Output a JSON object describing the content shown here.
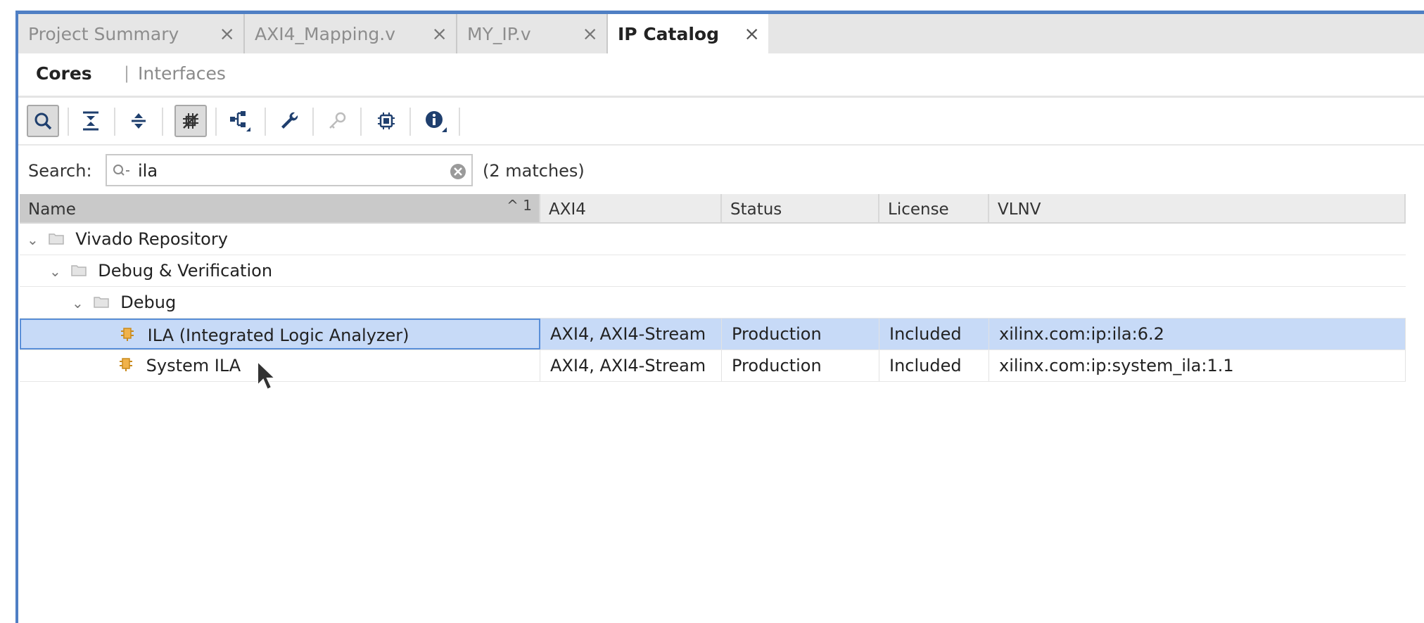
{
  "tabs": [
    {
      "label": "Project Summary",
      "close": "×"
    },
    {
      "label": "AXI4_Mapping.v",
      "close": "×"
    },
    {
      "label": "MY_IP.v",
      "close": "×"
    },
    {
      "label": "IP Catalog",
      "close": "×"
    }
  ],
  "subtabs": {
    "cores": "Cores",
    "divider": "|",
    "interfaces": "Interfaces"
  },
  "toolbar": {
    "icons": [
      "search-icon",
      "collapse-all-icon",
      "expand-all-icon",
      "filter-icon",
      "hierarchy-icon",
      "wrench-icon",
      "key-icon",
      "chip-icon",
      "info-icon"
    ]
  },
  "search": {
    "label": "Search:",
    "value": "ila",
    "matches": "(2 matches)"
  },
  "table": {
    "columns": [
      "Name",
      "AXI4",
      "Status",
      "License",
      "VLNV"
    ],
    "sort_indicator": "^ 1",
    "tree": [
      {
        "label": "Vivado Repository",
        "level": 0,
        "type": "folder"
      },
      {
        "label": "Debug & Verification",
        "level": 1,
        "type": "folder"
      },
      {
        "label": "Debug",
        "level": 2,
        "type": "folder"
      }
    ],
    "rows": [
      {
        "name": "ILA (Integrated Logic Analyzer)",
        "axi4": "AXI4, AXI4-Stream",
        "status": "Production",
        "license": "Included",
        "vlnv": "xilinx.com:ip:ila:6.2",
        "selected": true
      },
      {
        "name": "System ILA",
        "axi4": "AXI4, AXI4-Stream",
        "status": "Production",
        "license": "Included",
        "vlnv": "xilinx.com:ip:system_ila:1.1",
        "selected": false
      }
    ]
  },
  "colors": {
    "accent": "#4f7fc4",
    "selection": "#c7daf7"
  }
}
